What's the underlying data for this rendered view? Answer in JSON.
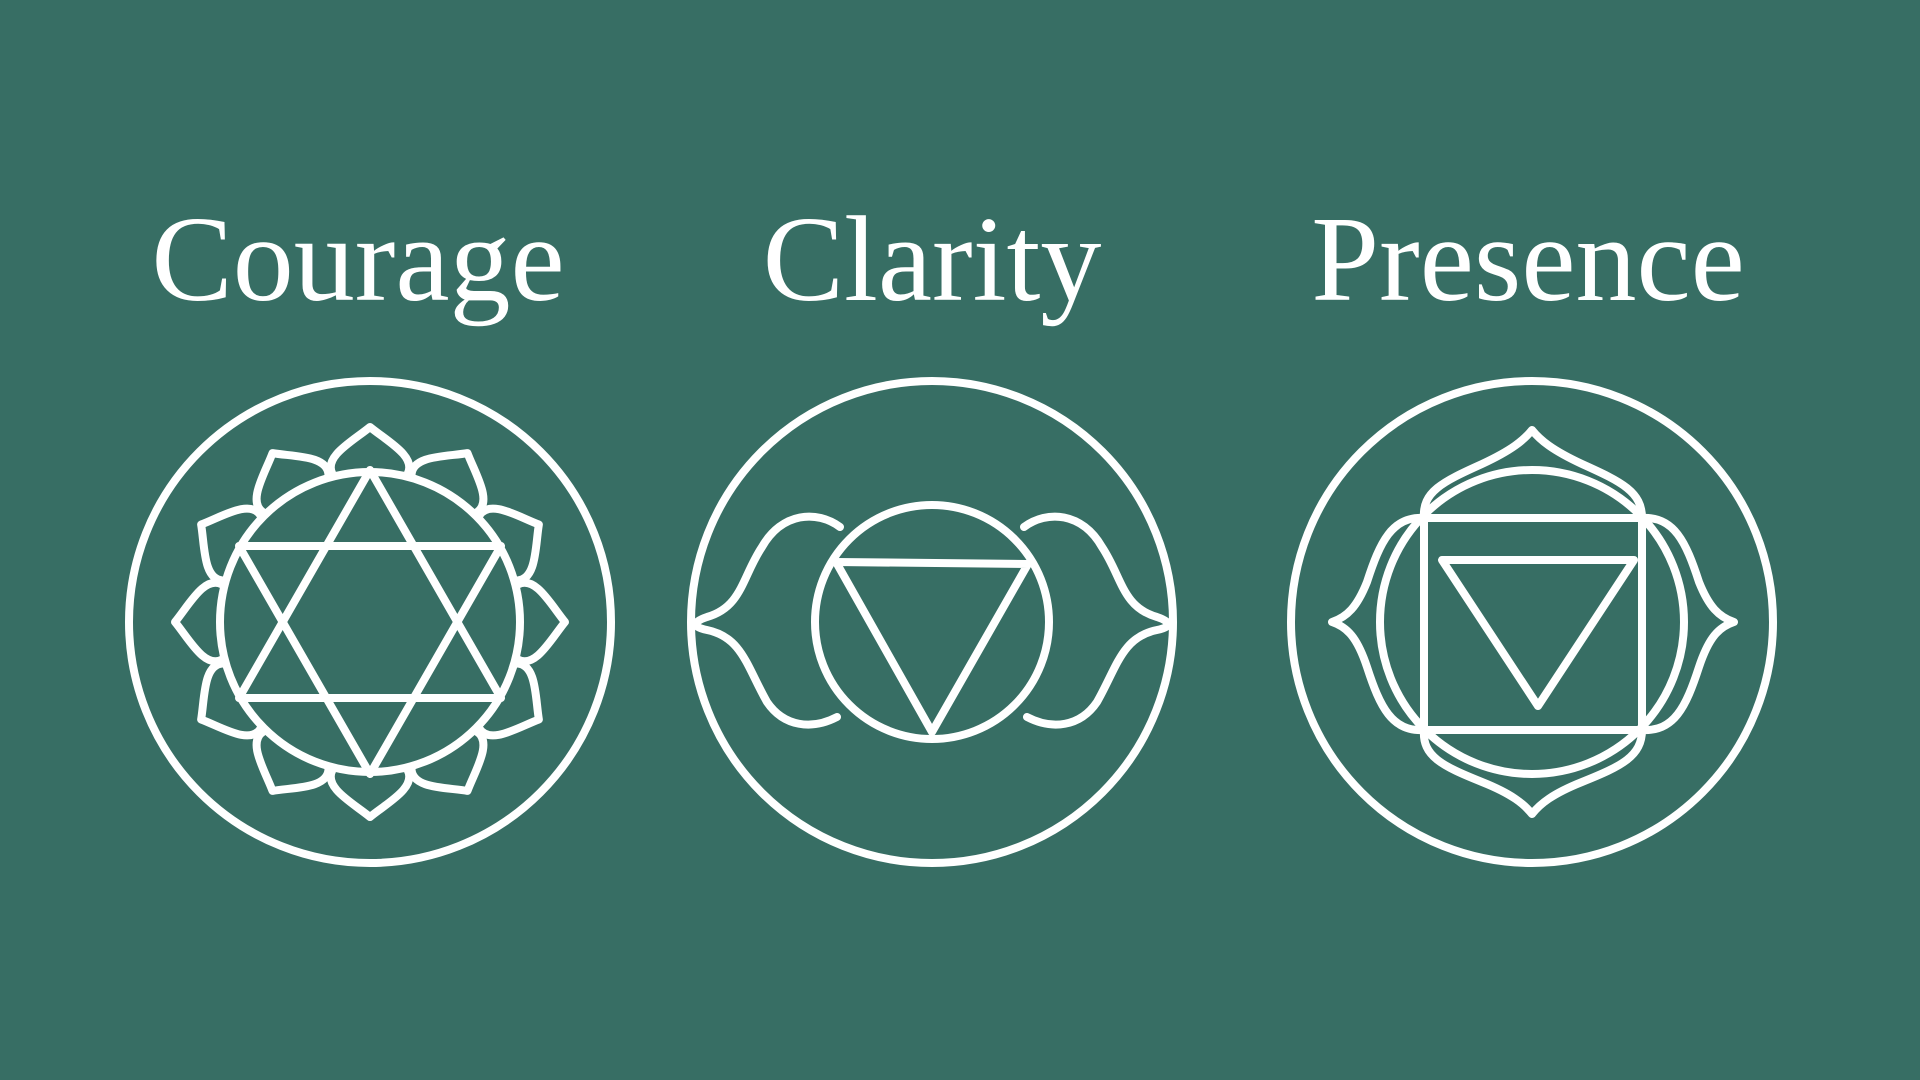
{
  "background_color": "#376e64",
  "foreground_color": "#ffffff",
  "items": [
    {
      "label": "Courage",
      "icon": "heart-chakra-icon"
    },
    {
      "label": "Clarity",
      "icon": "third-eye-chakra-icon"
    },
    {
      "label": "Presence",
      "icon": "root-chakra-icon"
    }
  ]
}
